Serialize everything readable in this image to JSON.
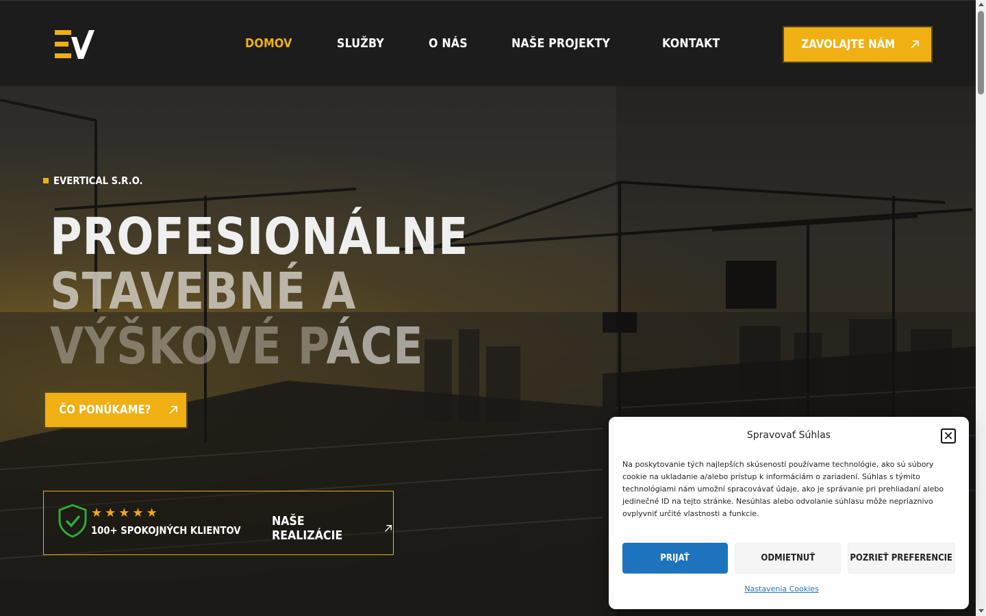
{
  "header": {
    "nav": [
      {
        "label": "DOMOV",
        "active": true
      },
      {
        "label": "SLUŽBY",
        "active": false
      },
      {
        "label": "O NÁS",
        "active": false
      },
      {
        "label": "NAŠE PROJEKTY",
        "active": false
      },
      {
        "label": "KONTAKT",
        "active": false
      }
    ],
    "call_button": "ZAVOLAJTE NÁM"
  },
  "hero": {
    "eyebrow": "EVERTICAL S.R.O.",
    "headline_line1": "PROFESIONÁLNE",
    "headline_line2": "STAVEBNÉ A",
    "headline_line3_faded": "VÝŠKOVÉ P",
    "headline_line3_bright": "ÁCE",
    "cta": "ČO PONÚKAME?",
    "trust": {
      "rating": 5,
      "clients": "100+ SPOKOJNÝCH KLIENTOV",
      "link": "NAŠE REALIZÁCIE"
    }
  },
  "cookie": {
    "title": "Spravovať Súhlas",
    "text": "Na poskytovanie tých najlepších skúseností používame technológie, ako sú súbory cookie na ukladanie a/alebo prístup k informáciám o zariadení. Súhlas s týmito technológiami nám umožní spracovávať údaje, ako je správanie pri prehliadaní alebo jedinečné ID na tejto stránke. Nesúhlas alebo odvolanie súhlasu môže nepriaznivo ovplyvniť určité vlastnosti a funkcie.",
    "accept": "PRIJAŤ",
    "deny": "ODMIETNUŤ",
    "preferences": "POZRIEŤ PREFERENCIE",
    "settings_link": "Nastavenia Cookies"
  },
  "colors": {
    "accent": "#f0b014",
    "header_bg": "#1c1c1c",
    "cookie_primary": "#1e73be",
    "shield": "#2eaa3c"
  }
}
